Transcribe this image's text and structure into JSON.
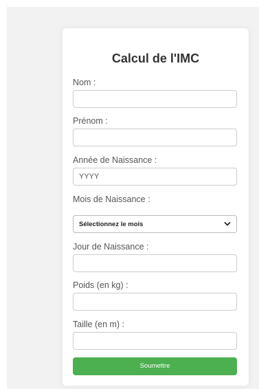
{
  "form": {
    "title": "Calcul de l'IMC",
    "fields": [
      {
        "label": "Nom :",
        "value": "",
        "placeholder": ""
      },
      {
        "label": "Prénom :",
        "value": "",
        "placeholder": ""
      },
      {
        "label": "Année de Naissance :",
        "value": "",
        "placeholder": "YYYY"
      },
      {
        "label": "Mois de Naissance :",
        "selected": "Sélectionnez le mois"
      },
      {
        "label": "Jour de Naissance :",
        "value": "",
        "placeholder": ""
      },
      {
        "label": "Poids (en kg) :",
        "value": "",
        "placeholder": ""
      },
      {
        "label": "Taille (en m) :",
        "value": "",
        "placeholder": ""
      }
    ],
    "submit_label": "Soumettre"
  },
  "colors": {
    "page_background": "#f2f2f2",
    "card_background": "#ffffff",
    "submit_button": "#4caf50",
    "title_text": "#333333"
  },
  "icons": {
    "select_arrow": "chevron-down-icon"
  }
}
